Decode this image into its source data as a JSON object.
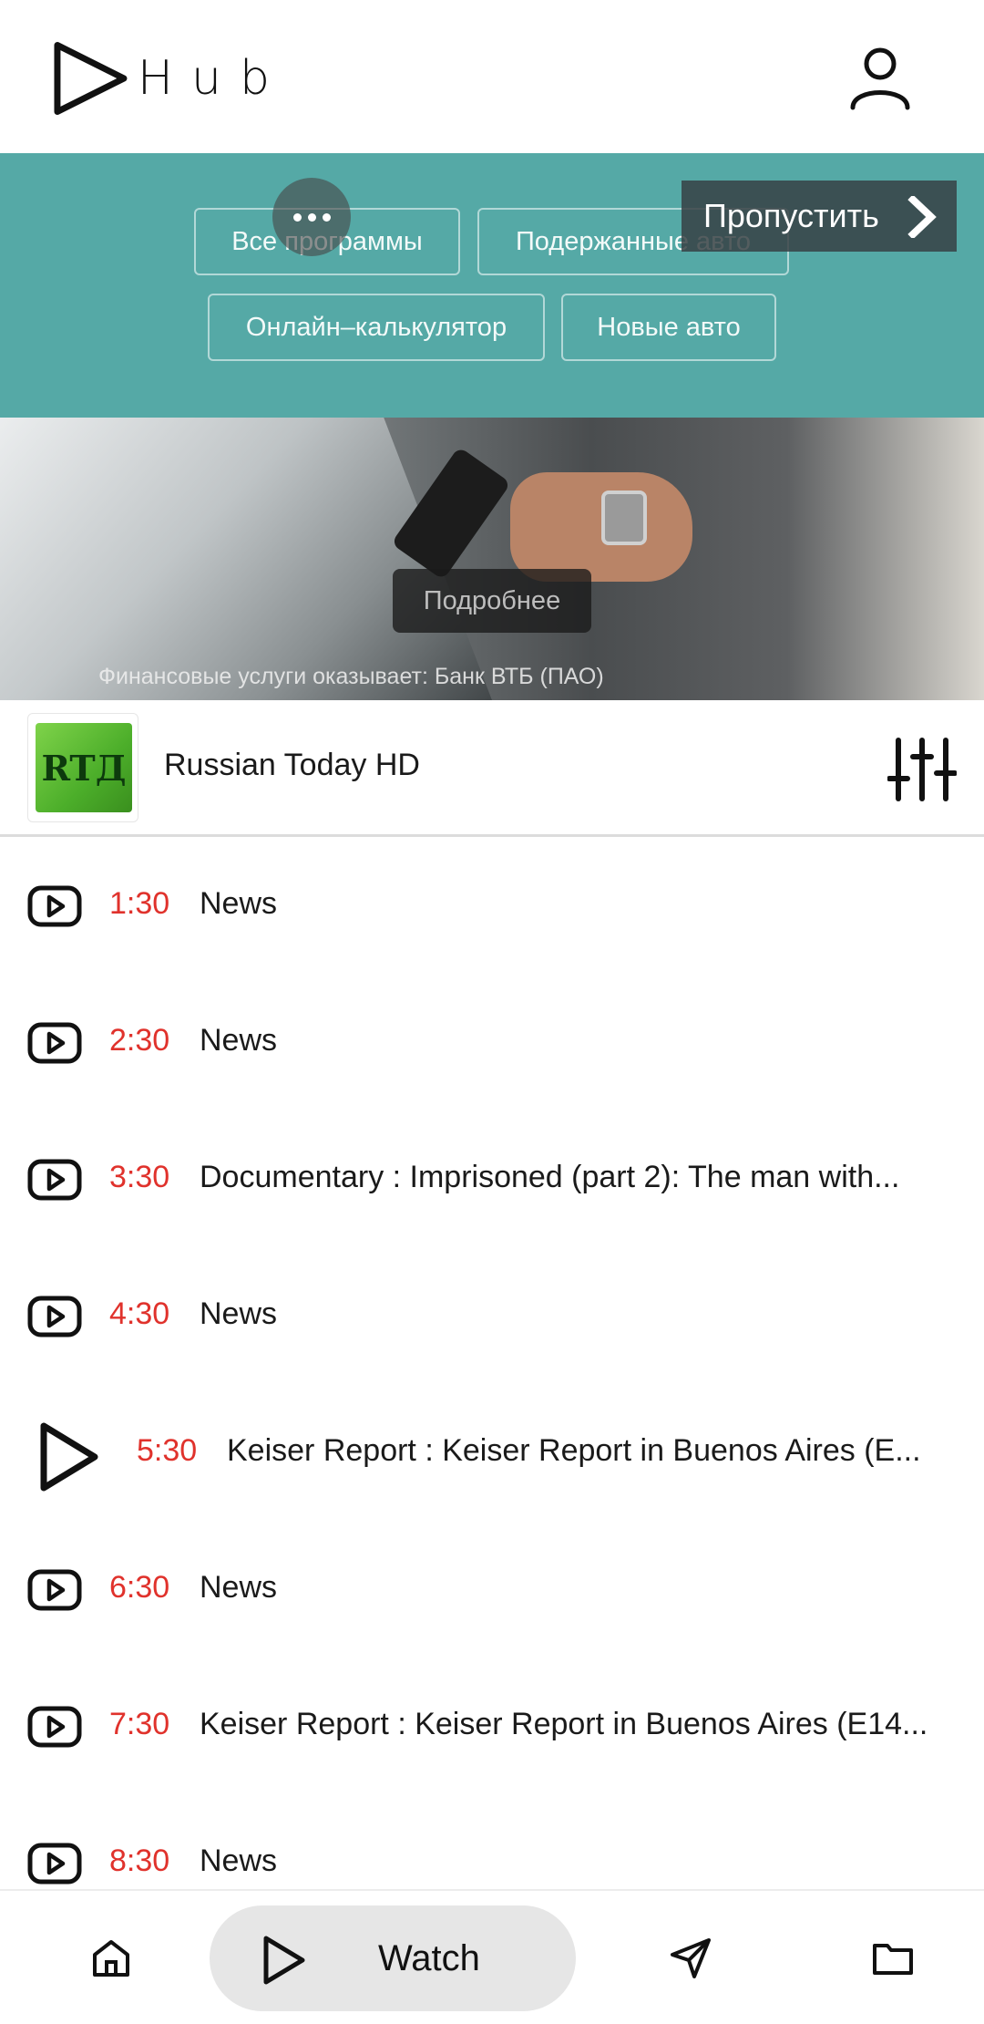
{
  "header": {
    "logo_text": "Hub",
    "logo_icon": "play-outline-icon",
    "profile_icon": "user-icon"
  },
  "ad": {
    "chips": [
      "Все программы",
      "Подержанные авто",
      "Онлайн–калькулятор",
      "Новые авто"
    ],
    "skip_label": "Пропустить",
    "more_info_label": "Подробнее",
    "disclaimer": "Финансовые услуги оказывает: Банк ВТБ (ПАО)",
    "background_color": "#55a9a6"
  },
  "channel": {
    "logo_text": "RTД",
    "name": "Russian Today HD",
    "filter_icon": "sliders-icon"
  },
  "schedule": [
    {
      "time": "1:30",
      "title": "News",
      "current": false
    },
    {
      "time": "2:30",
      "title": "News",
      "current": false
    },
    {
      "time": "3:30",
      "title": "Documentary : Imprisoned (part 2): The man with...",
      "current": false
    },
    {
      "time": "4:30",
      "title": "News",
      "current": false
    },
    {
      "time": "5:30",
      "title": "Keiser Report : Keiser Report in Buenos Aires (E...",
      "current": true
    },
    {
      "time": "6:30",
      "title": "News",
      "current": false
    },
    {
      "time": "7:30",
      "title": "Keiser Report : Keiser Report in Buenos Aires (E14...",
      "current": false
    },
    {
      "time": "8:30",
      "title": "News",
      "current": false
    }
  ],
  "bottom_nav": {
    "home_icon": "home-icon",
    "watch_label": "Watch",
    "send_icon": "send-icon",
    "folder_icon": "folder-icon"
  },
  "colors": {
    "time_accent": "#e0322c",
    "watch_pill": "#e6e6e6"
  }
}
